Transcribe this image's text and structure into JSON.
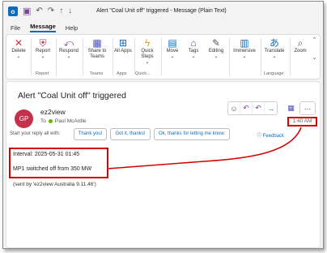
{
  "window": {
    "title": "Alert \"Coal Unit off\" triggered  -  Message (Plain Text)"
  },
  "quick_access": [
    "app-icon",
    "save-icon",
    "undo-icon",
    "redo-icon",
    "up-icon",
    "down-icon"
  ],
  "menu": {
    "tabs": [
      "File",
      "Message",
      "Help"
    ],
    "active": "Message"
  },
  "ribbon": {
    "buttons": [
      {
        "label": "Delete",
        "icon": "delete-x-icon"
      },
      {
        "label": "Report",
        "icon": "report-shield-icon"
      },
      {
        "label": "Respond",
        "icon": "respond-icon"
      },
      {
        "label": "Share to Teams",
        "icon": "teams-icon"
      },
      {
        "label": "All Apps",
        "icon": "apps-icon"
      },
      {
        "label": "Quick Steps",
        "icon": "lightning-icon"
      },
      {
        "label": "Move",
        "icon": "folder-icon"
      },
      {
        "label": "Tags",
        "icon": "tag-icon"
      },
      {
        "label": "Editing",
        "icon": "pencil-icon"
      },
      {
        "label": "Immersive",
        "icon": "book-icon"
      },
      {
        "label": "Translate",
        "icon": "translate-icon"
      },
      {
        "label": "Zoom",
        "icon": "zoom-icon"
      }
    ],
    "groups": [
      "Report",
      "Teams",
      "Apps",
      "Quick...",
      "Language"
    ]
  },
  "message": {
    "subject": "Alert \"Coal Unit off\" triggered",
    "avatar_initials": "GP",
    "sender": "ez2view",
    "to_label": "To",
    "recipient": "Paul McArdle",
    "time": "1:40 AM",
    "reply_hint": "Start your reply all with:",
    "suggested_replies": [
      "Thank you!",
      "Got it, thanks!",
      "Ok, thanks for letting me know."
    ],
    "feedback": "Feedback",
    "body": {
      "interval": "Interval: 2025-05-31 01:45",
      "event": "MP1 switched off from 350 MW",
      "signature": "(sent by 'ez2view Australia 9.11.46')"
    }
  },
  "colors": {
    "accent": "#0f6cbd",
    "highlight_red": "#d40000",
    "avatar_bg": "#c4314b",
    "presence_green": "#6bb700"
  }
}
